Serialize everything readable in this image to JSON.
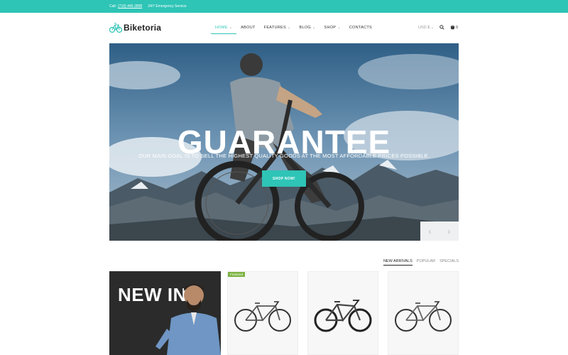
{
  "topbar": {
    "call_label": "Call:",
    "phone": "(719) 445-2808",
    "service": "24/7 Emergency Service"
  },
  "header": {
    "logo_text": "Biketoria",
    "nav": [
      {
        "label": "HOME",
        "has_dropdown": true,
        "active": true
      },
      {
        "label": "ABOUT",
        "has_dropdown": false
      },
      {
        "label": "FEATURES",
        "has_dropdown": true
      },
      {
        "label": "BLOG",
        "has_dropdown": true
      },
      {
        "label": "SHOP",
        "has_dropdown": true
      },
      {
        "label": "CONTACTS",
        "has_dropdown": false
      }
    ],
    "currency": "USD $",
    "cart_count": "0"
  },
  "hero": {
    "title": "GUARANTEE",
    "subtitle": "OUR MAIN GOAL IS TO SELL THE HIGHEST QUALITY GOODS AT THE MOST AFFORDABLE PRICES POSSIBLE.",
    "button_label": "SHOP NOW!"
  },
  "product_tabs": [
    {
      "label": "NEW ARRIVALS",
      "active": true
    },
    {
      "label": "POPULAR",
      "active": false
    },
    {
      "label": "SPECIALS",
      "active": false
    }
  ],
  "promo": {
    "text": "NEW IN"
  },
  "products": [
    {
      "badge": "Featured"
    },
    {
      "badge": ""
    },
    {
      "badge": ""
    }
  ],
  "colors": {
    "accent": "#2ec4b6",
    "badge": "#7cb342",
    "promo_bg": "#2b2b2b"
  },
  "icons": {
    "logo": "bicycle-icon",
    "search": "search-icon",
    "cart": "cart-icon",
    "prev": "chevron-left-icon",
    "next": "chevron-right-icon"
  }
}
